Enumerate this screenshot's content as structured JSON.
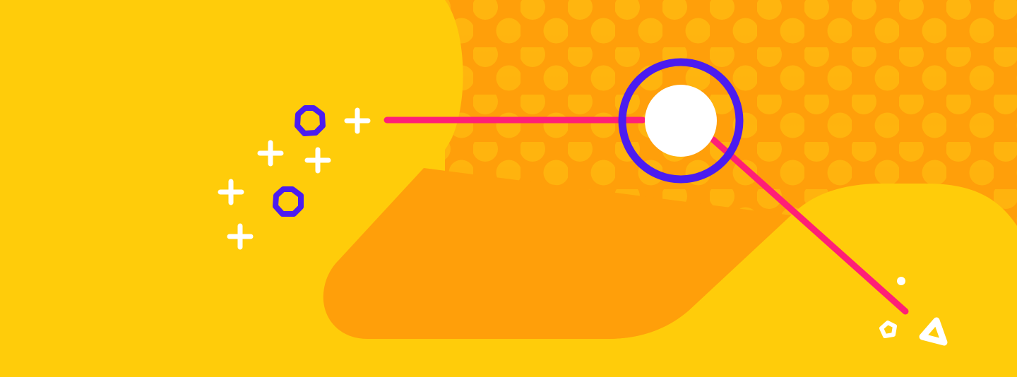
{
  "colors": {
    "background": "#ffcc0a",
    "orange": "#ff9f0a",
    "dots": "#ffb50f",
    "pink": "#ff1f77",
    "purple": "#4b1cf0",
    "white": "#ffffff"
  },
  "icons": [
    "plus-icon",
    "octagon-ring-icon",
    "target-circle-icon",
    "pentagon-icon",
    "triangle-icon",
    "dot-icon"
  ]
}
